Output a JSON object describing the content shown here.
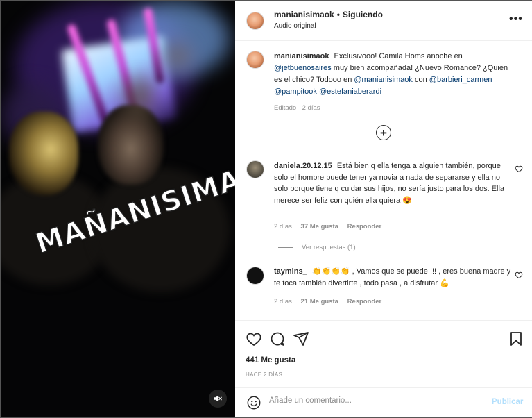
{
  "media": {
    "watermark": "MAÑANISIMA",
    "mute_icon": "speaker-muted-icon"
  },
  "header": {
    "username": "manianisimaok",
    "separator": "•",
    "follow_status": "Siguiendo",
    "subtitle": "Audio original",
    "more_icon": "more-options-icon",
    "more_label": "•••"
  },
  "caption": {
    "username": "manianisimaok",
    "text_1": "Exclusivooo! Camila Homs anoche en",
    "mention_1": "@jetbuenosaires",
    "text_2": "muy bien acompañada! ¿Nuevo Romance? ¿Quien es el chico? Todooo en",
    "mention_2": "@manianisimaok",
    "text_3": "con",
    "mention_3": "@barbieri_carmen",
    "mention_4": "@pampitook",
    "mention_5": "@estefaniaberardi",
    "meta": "Editado · 2 días",
    "plus_label": "+"
  },
  "comments": [
    {
      "username": "daniela.20.12.15",
      "text": "Está bien q ella tenga a alguien también, porque solo el hombre puede tener ya novia a nada de separarse y ella no solo porque tiene q cuidar sus hijos, no sería justo para los dos. Ella merece ser feliz con quién ella quiera",
      "emoji": "😍",
      "time": "2 días",
      "likes": "37 Me gusta",
      "reply": "Responder",
      "view_replies": "Ver respuestas (1)"
    },
    {
      "username": "taymins_",
      "emojis": "👏👏👏👏",
      "text": ", Vamos que se puede !!! , eres buena madre y te toca también divertirte , todo pasa , a disfrutar",
      "emoji_end": "💪",
      "time": "2 días",
      "likes": "21 Me gusta",
      "reply": "Responder"
    }
  ],
  "actions": {
    "like_icon": "heart-icon",
    "comment_icon": "comment-icon",
    "share_icon": "send-icon",
    "save_icon": "bookmark-icon",
    "likes": "441 Me gusta",
    "date": "HACE 2 DÍAS"
  },
  "comment_bar": {
    "emoji_icon": "smiley-icon",
    "placeholder": "Añade un comentario...",
    "publish_label": "Publicar"
  },
  "colors": {
    "link": "#00376b",
    "muted": "#8e8e8e",
    "publish_disabled": "#b2dffc"
  }
}
